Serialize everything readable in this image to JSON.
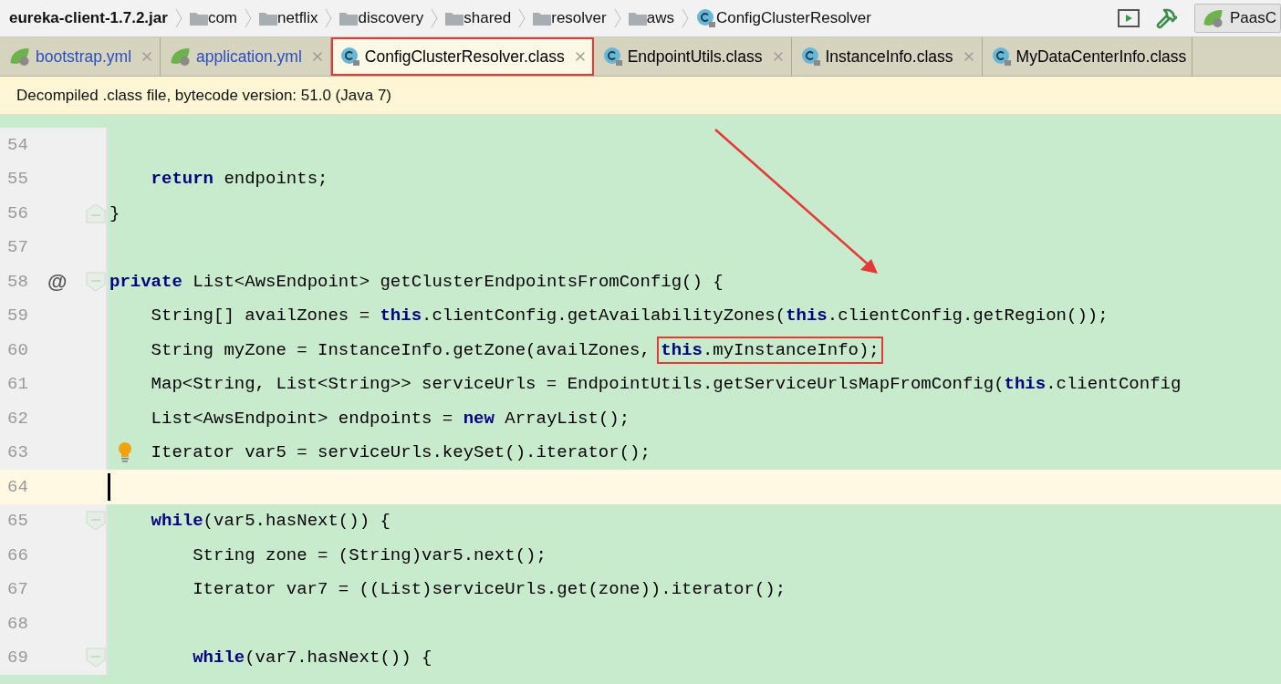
{
  "breadcrumb": [
    {
      "kind": "jar",
      "label": "eureka-client-1.7.2.jar"
    },
    {
      "kind": "folder",
      "label": "com"
    },
    {
      "kind": "folder",
      "label": "netflix"
    },
    {
      "kind": "folder",
      "label": "discovery"
    },
    {
      "kind": "folder",
      "label": "shared"
    },
    {
      "kind": "folder",
      "label": "resolver"
    },
    {
      "kind": "folder",
      "label": "aws"
    },
    {
      "kind": "class",
      "label": "ConfigClusterResolver"
    }
  ],
  "run_config": {
    "label": "PaasC"
  },
  "tabs": [
    {
      "kind": "spring",
      "label": "bootstrap.yml",
      "color": "#2a4fc0",
      "selected": false,
      "outlined": false,
      "closable": true
    },
    {
      "kind": "spring",
      "label": "application.yml",
      "color": "#2a4fc0",
      "selected": false,
      "outlined": false,
      "closable": true
    },
    {
      "kind": "class",
      "label": "ConfigClusterResolver.class",
      "color": "#000000",
      "selected": true,
      "outlined": true,
      "closable": true
    },
    {
      "kind": "class",
      "label": "EndpointUtils.class",
      "color": "#000000",
      "selected": false,
      "outlined": false,
      "closable": true
    },
    {
      "kind": "class",
      "label": "InstanceInfo.class",
      "color": "#000000",
      "selected": false,
      "outlined": false,
      "closable": true
    },
    {
      "kind": "class",
      "label": "MyDataCenterInfo.class",
      "color": "#000000",
      "selected": false,
      "outlined": false,
      "closable": false
    }
  ],
  "banner": "Decompiled .class file, bytecode version: 51.0 (Java 7)",
  "lines": [
    {
      "kind": "block",
      "children": [
        {
          "kind": "line",
          "number": "54",
          "current": false,
          "fold_start": false,
          "fold_end": false,
          "bulb": false
        },
        {
          "kind": "line",
          "number": "55",
          "current": false,
          "fold_start": false,
          "fold_end": false,
          "bulb": false,
          "tokens": [
            {
              "kind": "keyword",
              "text": "return"
            },
            {
              "kind": "plain",
              "text": " endpoints;"
            }
          ]
        }
      ]
    },
    {
      "kind": "line",
      "number": "56",
      "current": false,
      "fold_start": false,
      "fold_end": true,
      "bulb": false,
      "tokens": [
        {
          "kind": "plain",
          "text": "}"
        }
      ]
    },
    {
      "kind": "line",
      "number": "57",
      "current": false,
      "fold_start": false,
      "fold_end": false,
      "bulb": false
    },
    {
      "kind": "line",
      "number": "58",
      "current": false,
      "fold_start": true,
      "fold_end": false,
      "bulb": false,
      "gutter_mark": "@",
      "tokens": [
        {
          "kind": "keyword",
          "text": "private"
        },
        {
          "kind": "plain",
          "text": " List<AwsEndpoint> getClusterEndpointsFromConfig() {"
        }
      ]
    },
    {
      "kind": "block",
      "children": [
        {
          "kind": "line",
          "number": "59",
          "current": false,
          "fold_start": false,
          "fold_end": false,
          "bulb": false,
          "tokens": [
            {
              "kind": "plain",
              "text": "String[] availZones = "
            },
            {
              "kind": "keyword",
              "text": "this"
            },
            {
              "kind": "plain",
              "text": ".clientConfig.getAvailabilityZones("
            },
            {
              "kind": "keyword",
              "text": "this"
            },
            {
              "kind": "plain",
              "text": ".clientConfig.getRegion());"
            }
          ]
        },
        {
          "kind": "line",
          "number": "60",
          "current": false,
          "fold_start": false,
          "fold_end": false,
          "bulb": false,
          "tokens": [
            {
              "kind": "plain",
              "text": "String myZone = InstanceInfo.getZone(availZones, "
            },
            {
              "kind": "keyword",
              "text": "this",
              "boxed": true
            },
            {
              "kind": "plain",
              "text": ".myInstanceInfo);",
              "boxed": true
            }
          ]
        },
        {
          "kind": "line",
          "number": "61",
          "current": false,
          "fold_start": false,
          "fold_end": false,
          "bulb": false,
          "tokens": [
            {
              "kind": "plain",
              "text": "Map<String, List<String>> serviceUrls = EndpointUtils.getServiceUrlsMapFromConfig("
            },
            {
              "kind": "keyword",
              "text": "this"
            },
            {
              "kind": "plain",
              "text": ".clientConfig"
            }
          ]
        },
        {
          "kind": "line",
          "number": "62",
          "current": false,
          "fold_start": false,
          "fold_end": false,
          "bulb": false,
          "tokens": [
            {
              "kind": "plain",
              "text": "List<AwsEndpoint> endpoints = "
            },
            {
              "kind": "keyword",
              "text": "new"
            },
            {
              "kind": "plain",
              "text": " ArrayList();"
            }
          ]
        },
        {
          "kind": "line",
          "number": "63",
          "current": false,
          "fold_start": false,
          "fold_end": false,
          "bulb": true,
          "tokens": [
            {
              "kind": "plain",
              "text": "Iterator var5 = serviceUrls.keySet().iterator();"
            }
          ]
        },
        {
          "kind": "line",
          "number": "64",
          "current": true,
          "fold_start": false,
          "fold_end": false,
          "bulb": false
        },
        {
          "kind": "line",
          "number": "65",
          "current": false,
          "fold_start": true,
          "fold_end": false,
          "bulb": false,
          "tokens": [
            {
              "kind": "keyword",
              "text": "while"
            },
            {
              "kind": "plain",
              "text": "(var5.hasNext()) {"
            }
          ]
        },
        {
          "kind": "block",
          "children": [
            {
              "kind": "line",
              "number": "66",
              "current": false,
              "fold_start": false,
              "fold_end": false,
              "bulb": false,
              "tokens": [
                {
                  "kind": "plain",
                  "text": "String zone = (String)var5.next();"
                }
              ]
            },
            {
              "kind": "line",
              "number": "67",
              "current": false,
              "fold_start": false,
              "fold_end": false,
              "bulb": false,
              "tokens": [
                {
                  "kind": "plain",
                  "text": "Iterator var7 = ((List)serviceUrls.get(zone)).iterator();"
                }
              ]
            },
            {
              "kind": "line",
              "number": "68",
              "current": false,
              "fold_start": false,
              "fold_end": false,
              "bulb": false
            },
            {
              "kind": "line",
              "number": "69",
              "current": false,
              "fold_start": true,
              "fold_end": false,
              "bulb": false,
              "tokens": [
                {
                  "kind": "keyword",
                  "text": "while"
                },
                {
                  "kind": "plain",
                  "text": "(var7.hasNext()) {"
                }
              ]
            }
          ]
        }
      ]
    }
  ]
}
